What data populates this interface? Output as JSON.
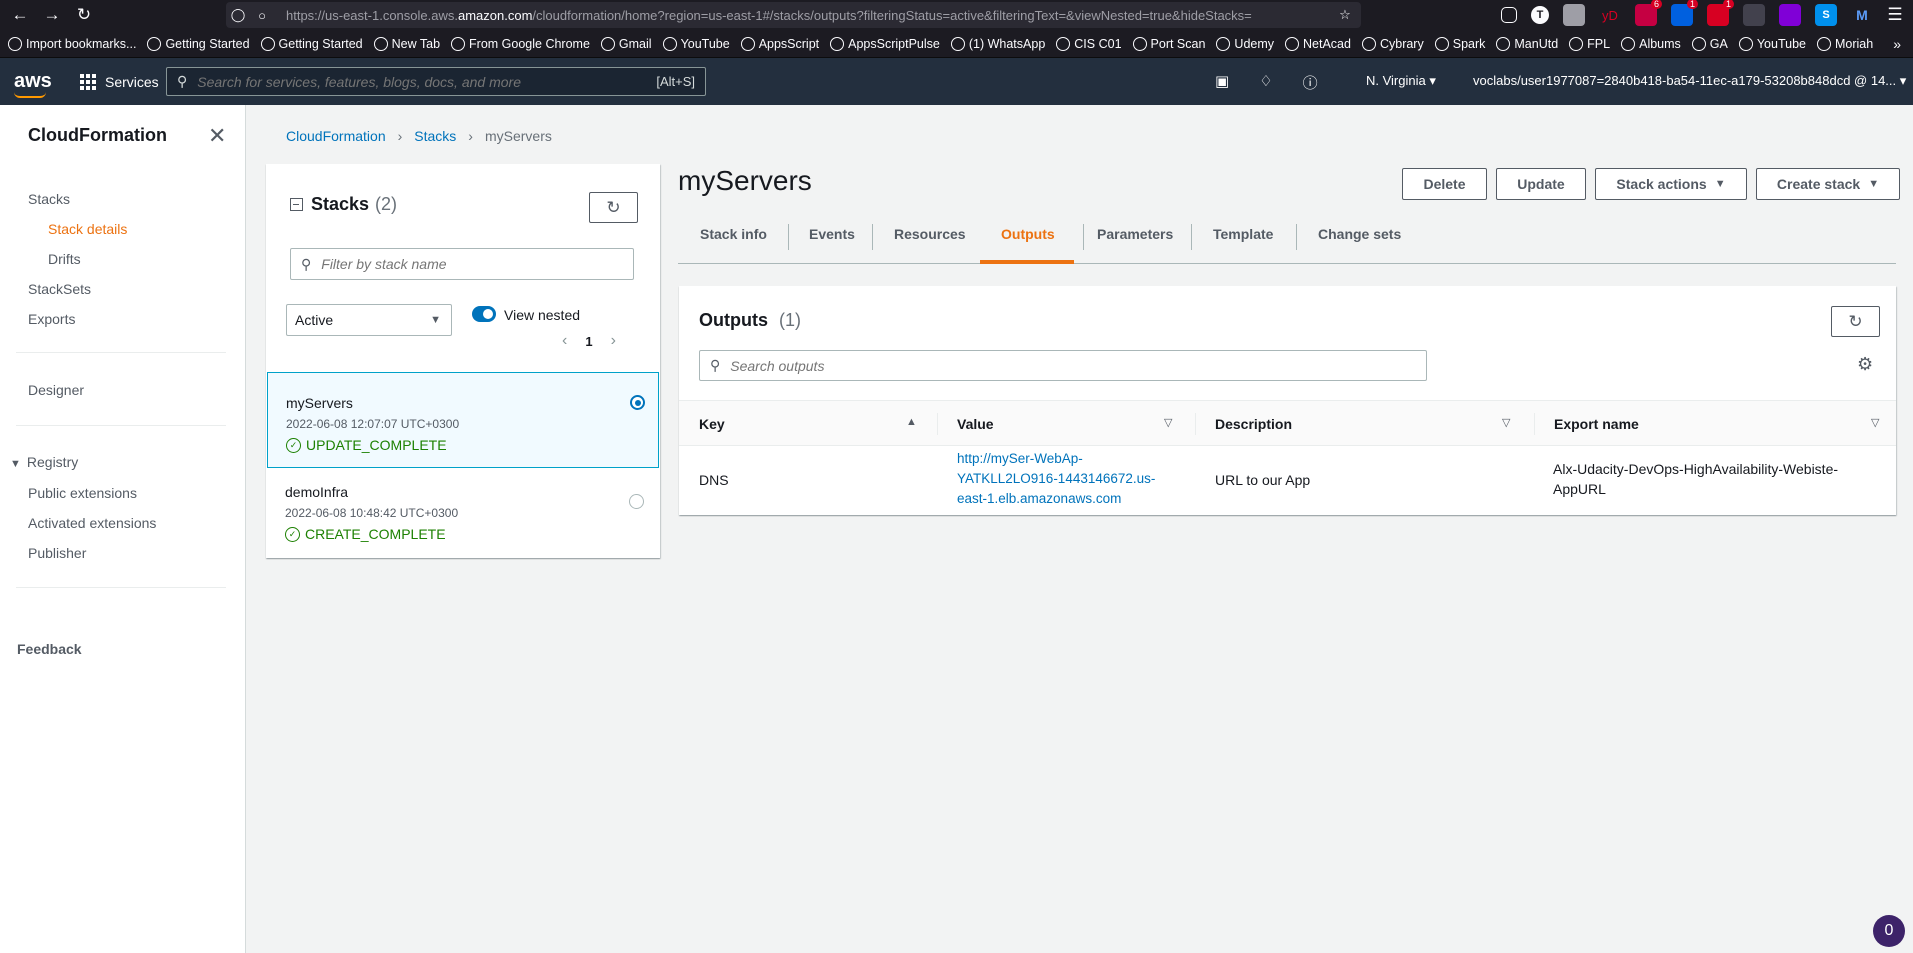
{
  "browser": {
    "url_prefix": "https://us-east-1.console.aws.",
    "url_domain": "amazon.com",
    "url_suffix": "/cloudformation/home?region=us-east-1#/stacks/outputs?filteringStatus=active&filteringText=&viewNested=true&hideStacks=",
    "bookmarks": [
      "Import bookmarks...",
      "Getting Started",
      "Getting Started",
      "New Tab",
      "From Google Chrome",
      "Gmail",
      "YouTube",
      "AppsScript",
      "AppsScriptPulse",
      "(1) WhatsApp",
      "CIS C01",
      "Port Scan",
      "Udemy",
      "NetAcad",
      "Cybrary",
      "Spark",
      "ManUtd",
      "FPL",
      "Albums",
      "GA",
      "YouTube",
      "Moriah"
    ],
    "ext_badges": [
      "6",
      "1",
      "1"
    ],
    "ext_text": "yD"
  },
  "aws_nav": {
    "logo": "aws",
    "services": "Services",
    "search_placeholder": "Search for services, features, blogs, docs, and more",
    "search_shortcut": "[Alt+S]",
    "region": "N. Virginia",
    "account": "voclabs/user1977087=2840b418-ba54-11ec-a179-53208b848dcd @ 14..."
  },
  "sidebar": {
    "title": "CloudFormation",
    "items": [
      "Stacks",
      "Stack details",
      "Drifts",
      "StackSets",
      "Exports",
      "Designer"
    ],
    "registry_label": "Registry",
    "registry_items": [
      "Public extensions",
      "Activated extensions",
      "Publisher"
    ],
    "feedback": "Feedback"
  },
  "breadcrumb": [
    "CloudFormation",
    "Stacks",
    "myServers"
  ],
  "stacks_panel": {
    "title": "Stacks",
    "count": "(2)",
    "filter_placeholder": "Filter by stack name",
    "status_filter": "Active",
    "view_nested_label": "View nested",
    "page": "1",
    "stacks": [
      {
        "name": "myServers",
        "date": "2022-06-08 12:07:07 UTC+0300",
        "status": "UPDATE_COMPLETE"
      },
      {
        "name": "demoInfra",
        "date": "2022-06-08 10:48:42 UTC+0300",
        "status": "CREATE_COMPLETE"
      }
    ]
  },
  "main": {
    "title": "myServers",
    "buttons": {
      "delete": "Delete",
      "update": "Update",
      "stack_actions": "Stack actions",
      "create_stack": "Create stack"
    },
    "tabs": [
      "Stack info",
      "Events",
      "Resources",
      "Outputs",
      "Parameters",
      "Template",
      "Change sets"
    ],
    "active_tab": "Outputs"
  },
  "outputs": {
    "title": "Outputs",
    "count": "(1)",
    "search_placeholder": "Search outputs",
    "columns": [
      "Key",
      "Value",
      "Description",
      "Export name"
    ],
    "rows": [
      {
        "key": "DNS",
        "value_lines": [
          "http://mySer-WebAp-",
          "YATKLL2LO916-1443146672.us-",
          "east-1.elb.amazonaws.com"
        ],
        "description": "URL to our App",
        "export_lines": [
          "Alx-Udacity-DevOps-HighAvailability-Webiste-",
          "AppURL"
        ]
      }
    ]
  },
  "help_badge": "0"
}
